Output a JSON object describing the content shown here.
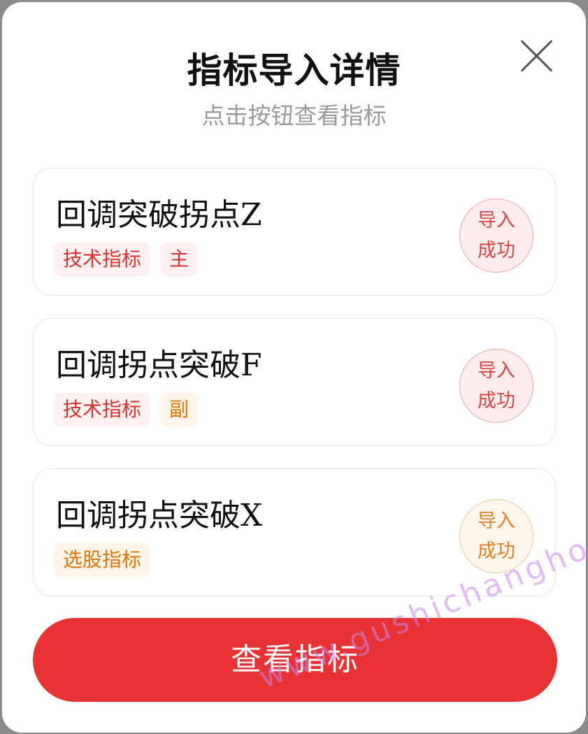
{
  "dialog": {
    "title": "指标导入详情",
    "subtitle": "点击按钮查看指标",
    "close_icon": "close-icon"
  },
  "indicators": [
    {
      "name": "回调突破拐点Z",
      "tags": [
        {
          "label": "技术指标",
          "color": "red"
        },
        {
          "label": "主",
          "color": "red"
        }
      ],
      "status_line1": "导入",
      "status_line2": "成功",
      "status_color": "red"
    },
    {
      "name": "回调拐点突破F",
      "tags": [
        {
          "label": "技术指标",
          "color": "red"
        },
        {
          "label": "副",
          "color": "orange"
        }
      ],
      "status_line1": "导入",
      "status_line2": "成功",
      "status_color": "red"
    },
    {
      "name": "回调拐点突破X",
      "tags": [
        {
          "label": "选股指标",
          "color": "orange"
        }
      ],
      "status_line1": "导入",
      "status_line2": "成功",
      "status_color": "orange"
    }
  ],
  "primary_button": {
    "label": "查看指标"
  },
  "watermark": "www.gushichanghong.com",
  "colors": {
    "accent_red": "#e83233",
    "tag_red": "#d93030",
    "tag_orange": "#e27400"
  }
}
